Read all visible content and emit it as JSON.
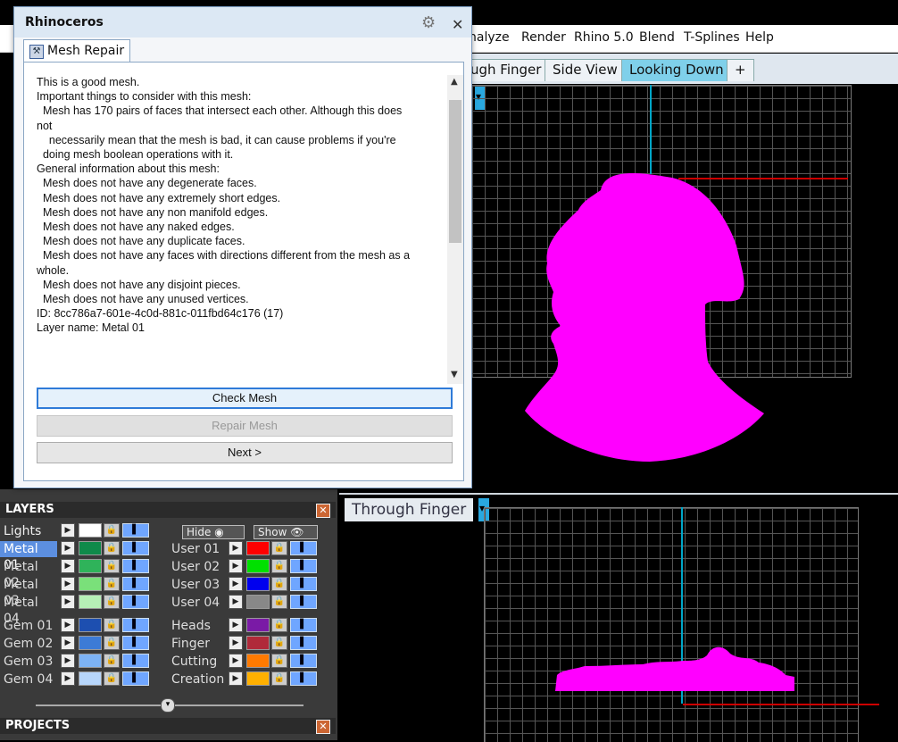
{
  "app": {
    "menus": [
      "nalyze",
      "Render",
      "Rhino 5.0",
      "Blend",
      "T-Splines",
      "Help"
    ],
    "viewport_tabs": [
      {
        "label": "ugh Finger",
        "active": false
      },
      {
        "label": "Side View",
        "active": false
      },
      {
        "label": "Looking Down",
        "active": true
      },
      {
        "label": "+",
        "active": false
      }
    ],
    "bottom_viewport_title": "Through Finger"
  },
  "dialog": {
    "title": "Rhinoceros",
    "tab": "Mesh Repair",
    "report_lines": [
      "This is a good mesh.",
      "",
      "Important things to consider with this mesh:",
      "  Mesh has 170 pairs of faces that intersect each other. Although this does",
      "not",
      "    necessarily mean that the mesh is bad, it can cause problems if you're",
      "  doing mesh boolean operations with it.",
      "",
      "General information about this mesh:",
      "  Mesh does not have any degenerate faces.",
      "  Mesh does not have any extremely short edges.",
      "  Mesh does not have any non manifold edges.",
      "  Mesh does not have any naked edges.",
      "  Mesh does not have any duplicate faces.",
      "  Mesh does not have any faces with directions different from the mesh as a",
      "whole.",
      "  Mesh does not have any disjoint pieces.",
      "  Mesh does not have any unused vertices.",
      "",
      "ID: 8cc786a7-601e-4c0d-881c-011fbd64c176 (17)",
      "Layer name: Metal 01"
    ],
    "buttons": {
      "check": "Check Mesh",
      "repair": "Repair Mesh",
      "next": "Next >"
    }
  },
  "layers": {
    "header": "LAYERS",
    "hide_label": "Hide",
    "show_label": "Show",
    "lights": {
      "name": "Lights",
      "color": "#ffffff"
    },
    "left": [
      {
        "name": "Metal 01",
        "color": "#0f8a4a",
        "selected": true
      },
      {
        "name": "Metal 02",
        "color": "#2fb35a",
        "selected": false
      },
      {
        "name": "Metal 03",
        "color": "#7ae07a",
        "selected": false
      },
      {
        "name": "Metal 04",
        "color": "#b6f0b6",
        "selected": false
      },
      {
        "name": "Gem 01",
        "color": "#1d4fb0",
        "selected": false
      },
      {
        "name": "Gem 02",
        "color": "#3c7bd6",
        "selected": false
      },
      {
        "name": "Gem 03",
        "color": "#7db3f5",
        "selected": false
      },
      {
        "name": "Gem 04",
        "color": "#b7d6fb",
        "selected": false
      }
    ],
    "right": [
      {
        "name": "User 01",
        "color": "#ff0000"
      },
      {
        "name": "User 02",
        "color": "#00e000"
      },
      {
        "name": "User 03",
        "color": "#0000ee"
      },
      {
        "name": "User 04",
        "color": "#888888"
      },
      {
        "name": "Heads",
        "color": "#7a1aa6"
      },
      {
        "name": "Finger",
        "color": "#b02a3a"
      },
      {
        "name": "Cutting",
        "color": "#ff7a00"
      },
      {
        "name": "Creation",
        "color": "#ffb000"
      }
    ],
    "projects_header": "PROJECTS"
  },
  "colors": {
    "object": "#ff00ff",
    "axis_x": "#cc0000",
    "axis_y": "#00a6c8",
    "dialog_primary_border": "#2f7bd8"
  }
}
